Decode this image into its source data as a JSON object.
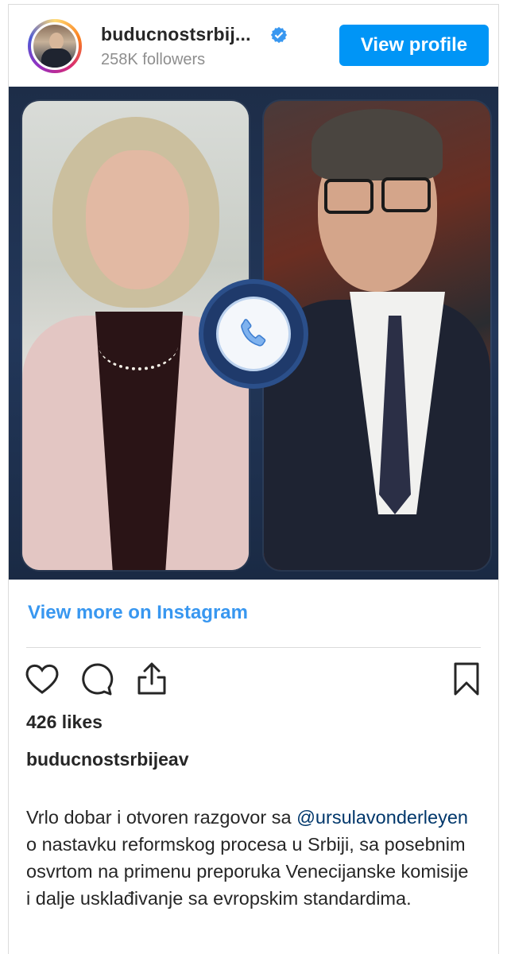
{
  "header": {
    "username": "buducnostsrbij...",
    "followers": "258K followers",
    "view_profile_label": "View profile"
  },
  "media": {
    "call_icon": "phone-icon"
  },
  "footer": {
    "view_more_label": "View more on Instagram",
    "likes": "426 likes",
    "author": "buducnostsrbijeav",
    "caption_prefix": "Vrlo dobar i otvoren razgovor sa",
    "caption_mention": "@ursulavonderleyen",
    "caption_suffix": "o nastavku reformskog procesa u Srbiji, sa posebnim osvrtom na primenu preporuka Venecijanske komisije i dalje usklađivanje sa evropskim standardima."
  },
  "icons": {
    "verified": "verified-badge-icon",
    "like": "heart-icon",
    "comment": "comment-icon",
    "share": "share-icon",
    "save": "bookmark-icon"
  },
  "colors": {
    "accent": "#0095f6",
    "link": "#3897f0",
    "mention": "#00376b",
    "text": "#262626",
    "muted": "#8e8e8e"
  }
}
